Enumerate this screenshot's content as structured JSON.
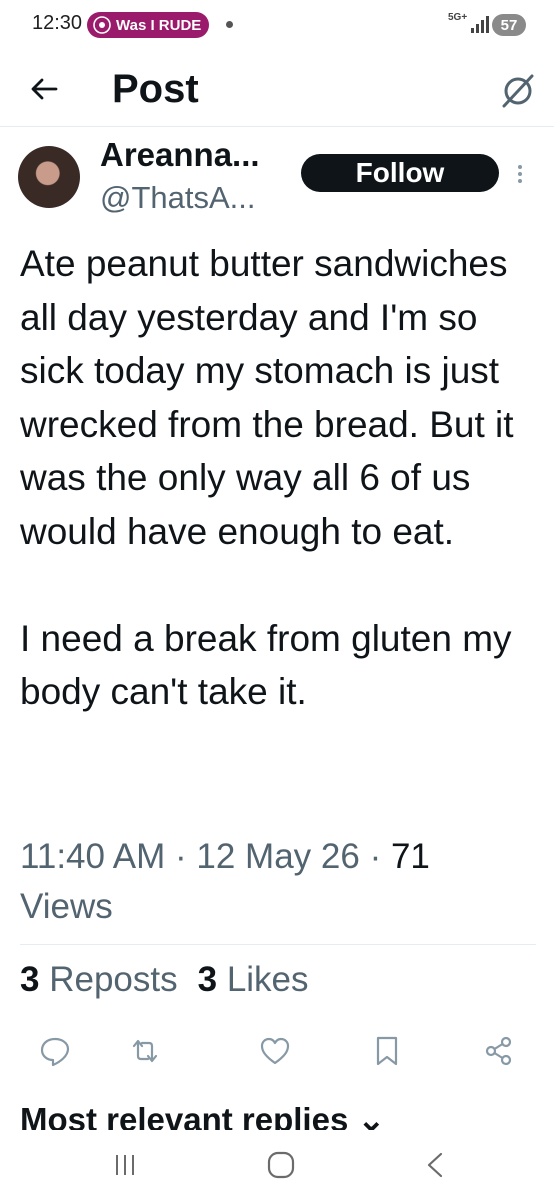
{
  "status_bar": {
    "time": "12:30",
    "pill_label": "Was I RUDE",
    "network": "5G+",
    "battery": "57"
  },
  "header": {
    "title": "Post"
  },
  "author": {
    "name": "Areanna...",
    "handle": "@ThatsA...",
    "follow_label": "Follow"
  },
  "post": {
    "text": "Ate peanut butter sandwiches all day yesterday and I'm so sick today my stomach is just wrecked from the bread. But it was the only way all 6 of us would have enough to eat.\n\nI need a break from gluten my body can't take it.",
    "time": "11:40 AM",
    "date": "12 May 26",
    "views_count": "71",
    "views_label": "Views"
  },
  "stats": {
    "reposts_count": "3",
    "reposts_label": "Reposts",
    "likes_count": "3",
    "likes_label": "Likes"
  },
  "replies_header": "Most relevant replies",
  "colors": {
    "text": "#0f1419",
    "muted": "#536471",
    "pill": "#9a1a6b",
    "divider": "#e6ecf0"
  },
  "icons": [
    "back-arrow-icon",
    "grok-icon",
    "more-icon",
    "reply-icon",
    "repost-icon",
    "like-icon",
    "bookmark-icon",
    "share-icon",
    "recents-icon",
    "home-icon",
    "nav-back-icon"
  ]
}
